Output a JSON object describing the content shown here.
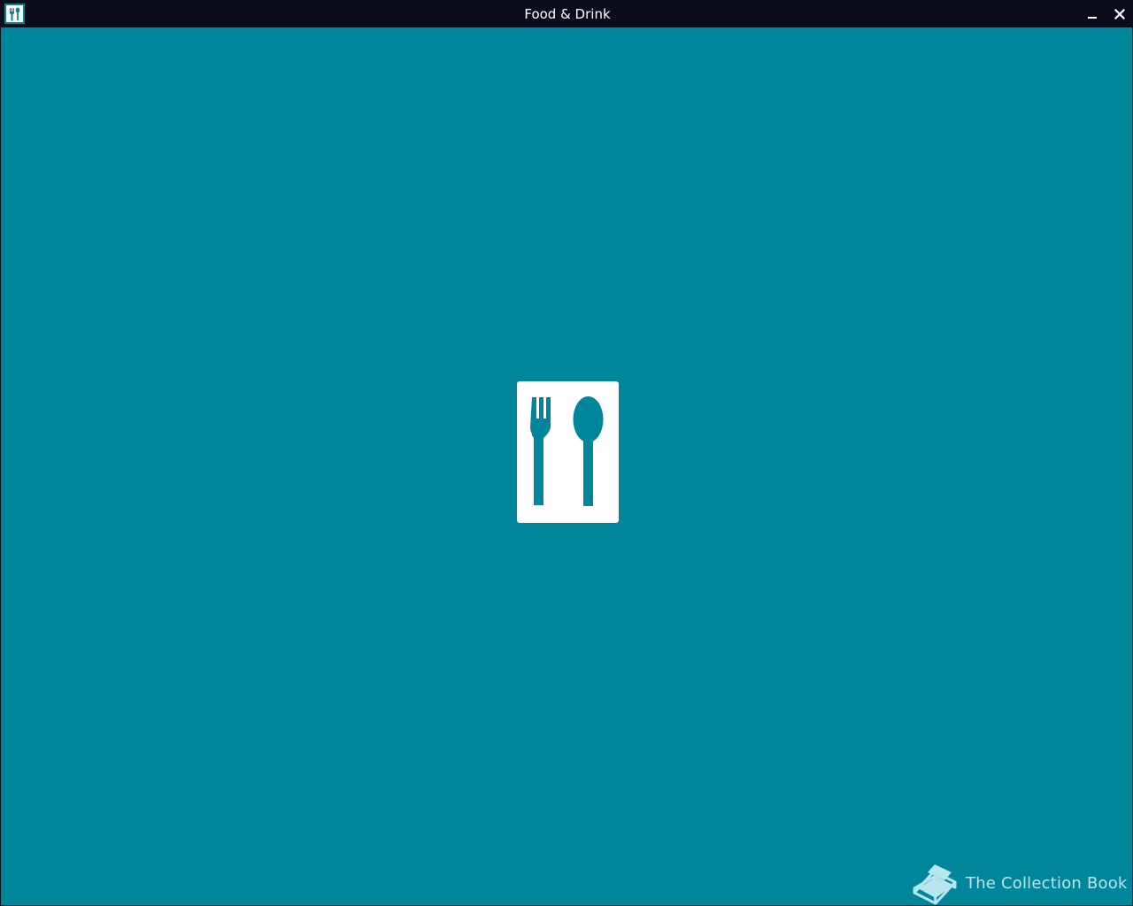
{
  "window": {
    "title": "Food & Drink"
  },
  "titlebar": {
    "app_icon": "fork-spoon-icon",
    "minimize_icon": "minimize-icon",
    "close_icon": "close-icon"
  },
  "splash": {
    "logo_icon": "fork-spoon-icon"
  },
  "brand": {
    "icon": "book-icon",
    "label": "The Collection Book"
  },
  "colors": {
    "background": "#00869b",
    "titlebar": "#0c0d1b",
    "logo": "#ffffff",
    "brand_text": "#b9e6ee"
  }
}
